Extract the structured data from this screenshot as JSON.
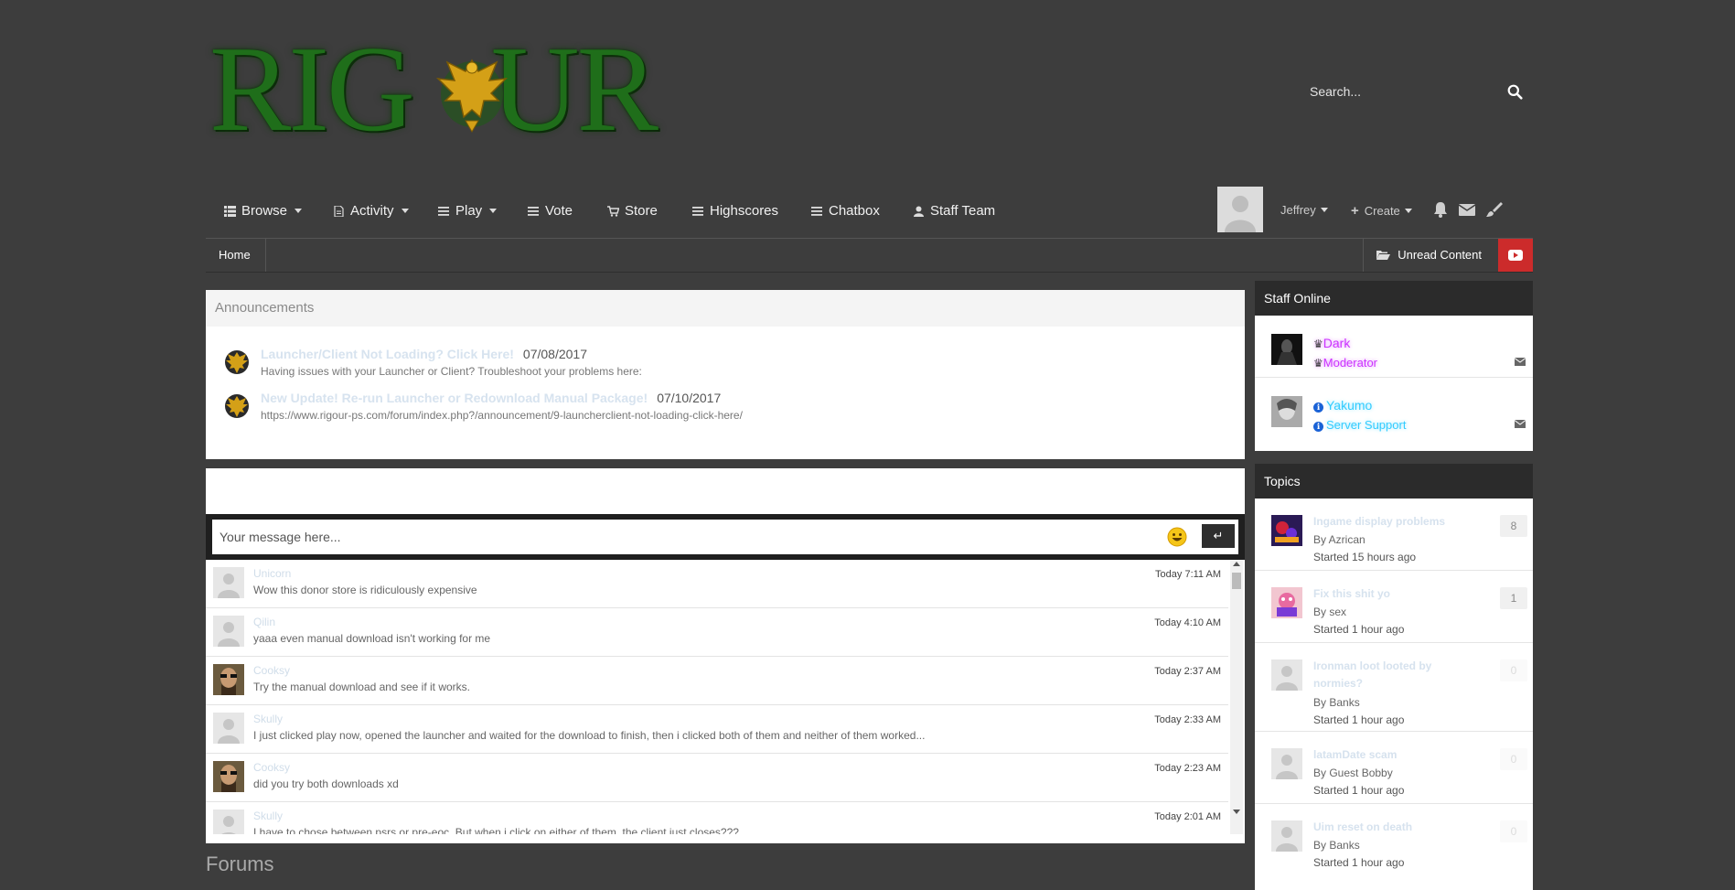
{
  "brand": {
    "logo_text_left": "RIG",
    "logo_text_right": "UR",
    "name": "RIGOUR"
  },
  "search": {
    "placeholder": "Search...",
    "icon": "search-icon"
  },
  "nav": {
    "items": [
      {
        "label": "Browse",
        "icon": "list-icon",
        "dropdown": true
      },
      {
        "label": "Activity",
        "icon": "document-icon",
        "dropdown": true
      },
      {
        "label": "Play",
        "icon": "menu-icon",
        "dropdown": true
      },
      {
        "label": "Vote",
        "icon": "menu-icon",
        "dropdown": false
      },
      {
        "label": "Store",
        "icon": "cart-icon",
        "dropdown": false
      },
      {
        "label": "Highscores",
        "icon": "menu-icon",
        "dropdown": false
      },
      {
        "label": "Chatbox",
        "icon": "menu-icon",
        "dropdown": false
      },
      {
        "label": "Staff Team",
        "icon": "user-icon",
        "dropdown": false
      }
    ],
    "user": {
      "name": "Jeffrey"
    },
    "create_label": "Create",
    "icons": [
      "bell-icon",
      "envelope-icon",
      "brush-icon"
    ]
  },
  "breadcrumb": {
    "home": "Home",
    "unread": "Unread Content"
  },
  "announcements": {
    "heading": "Announcements",
    "items": [
      {
        "title": "Launcher/Client Not Loading? Click Here!",
        "date": "07/08/2017",
        "desc": "Having issues with your Launcher or Client? Troubleshoot your problems here:"
      },
      {
        "title": "New Update! Re-run Launcher or Redownload Manual Package!",
        "date": "07/10/2017",
        "desc": "https://www.rigour-ps.com/forum/index.php?/announcement/9-launcherclient-not-loading-click-here/"
      }
    ]
  },
  "chat": {
    "placeholder": "Your message here...",
    "send_label": "↵",
    "messages": [
      {
        "user": "Unicorn",
        "text": "Wow this donor store is ridiculously expensive",
        "time": "Today 7:11 AM",
        "avatar": "default"
      },
      {
        "user": "Qilin",
        "text": "yaaa even manual download isn't working for me",
        "time": "Today 4:10 AM",
        "avatar": "default"
      },
      {
        "user": "Cooksy",
        "text": "Try the manual download and see if it works.",
        "time": "Today 2:37 AM",
        "avatar": "photo"
      },
      {
        "user": "Skully",
        "text": "I just clicked play now, opened the launcher and waited for the download to finish, then i clicked both of them and neither of them worked...",
        "time": "Today 2:33 AM",
        "avatar": "default"
      },
      {
        "user": "Cooksy",
        "text": "did you try both downloads xd",
        "time": "Today 2:23 AM",
        "avatar": "photo"
      },
      {
        "user": "Skully",
        "text": "I have to chose between psrs or pre-eoc. But when i click on either of them, the client just closes???",
        "time": "Today 2:01 AM",
        "avatar": "default"
      }
    ]
  },
  "forums": {
    "title": "Forums"
  },
  "staff_online": {
    "heading": "Staff Online",
    "members": [
      {
        "name": "Dark",
        "role": "Moderator",
        "color": "#cc33ff",
        "glyph": "♛"
      },
      {
        "name": "Yakumo",
        "role": "Server Support",
        "color": "#33ccff",
        "glyph": "ℹ"
      }
    ]
  },
  "topics": {
    "heading": "Topics",
    "items": [
      {
        "title": "Ingame display problems",
        "by": "By Azrican",
        "started": "Started 15 hours ago",
        "count": "8",
        "avatar": "art1"
      },
      {
        "title": "Fix this shit yo",
        "by": "By sex",
        "started": "Started 1 hour ago",
        "count": "1",
        "avatar": "art2"
      },
      {
        "title": "Ironman loot looted by normies?",
        "by": "By Banks",
        "started": "Started 1 hour ago",
        "count": "0",
        "avatar": "default"
      },
      {
        "title": "latamDate scam",
        "by": "By Guest Bobby",
        "started": "Started 1 hour ago",
        "count": "0",
        "avatar": "default"
      },
      {
        "title": "Uim reset on death",
        "by": "By Banks",
        "started": "Started 1 hour ago",
        "count": "0",
        "avatar": "default"
      }
    ]
  },
  "colors": {
    "background": "#3d3d3d",
    "sidebar_header": "#2b2b2b",
    "youtube": "#cc2b2b",
    "logo_green": "#1f6e1a",
    "gold": "#d4a017"
  }
}
